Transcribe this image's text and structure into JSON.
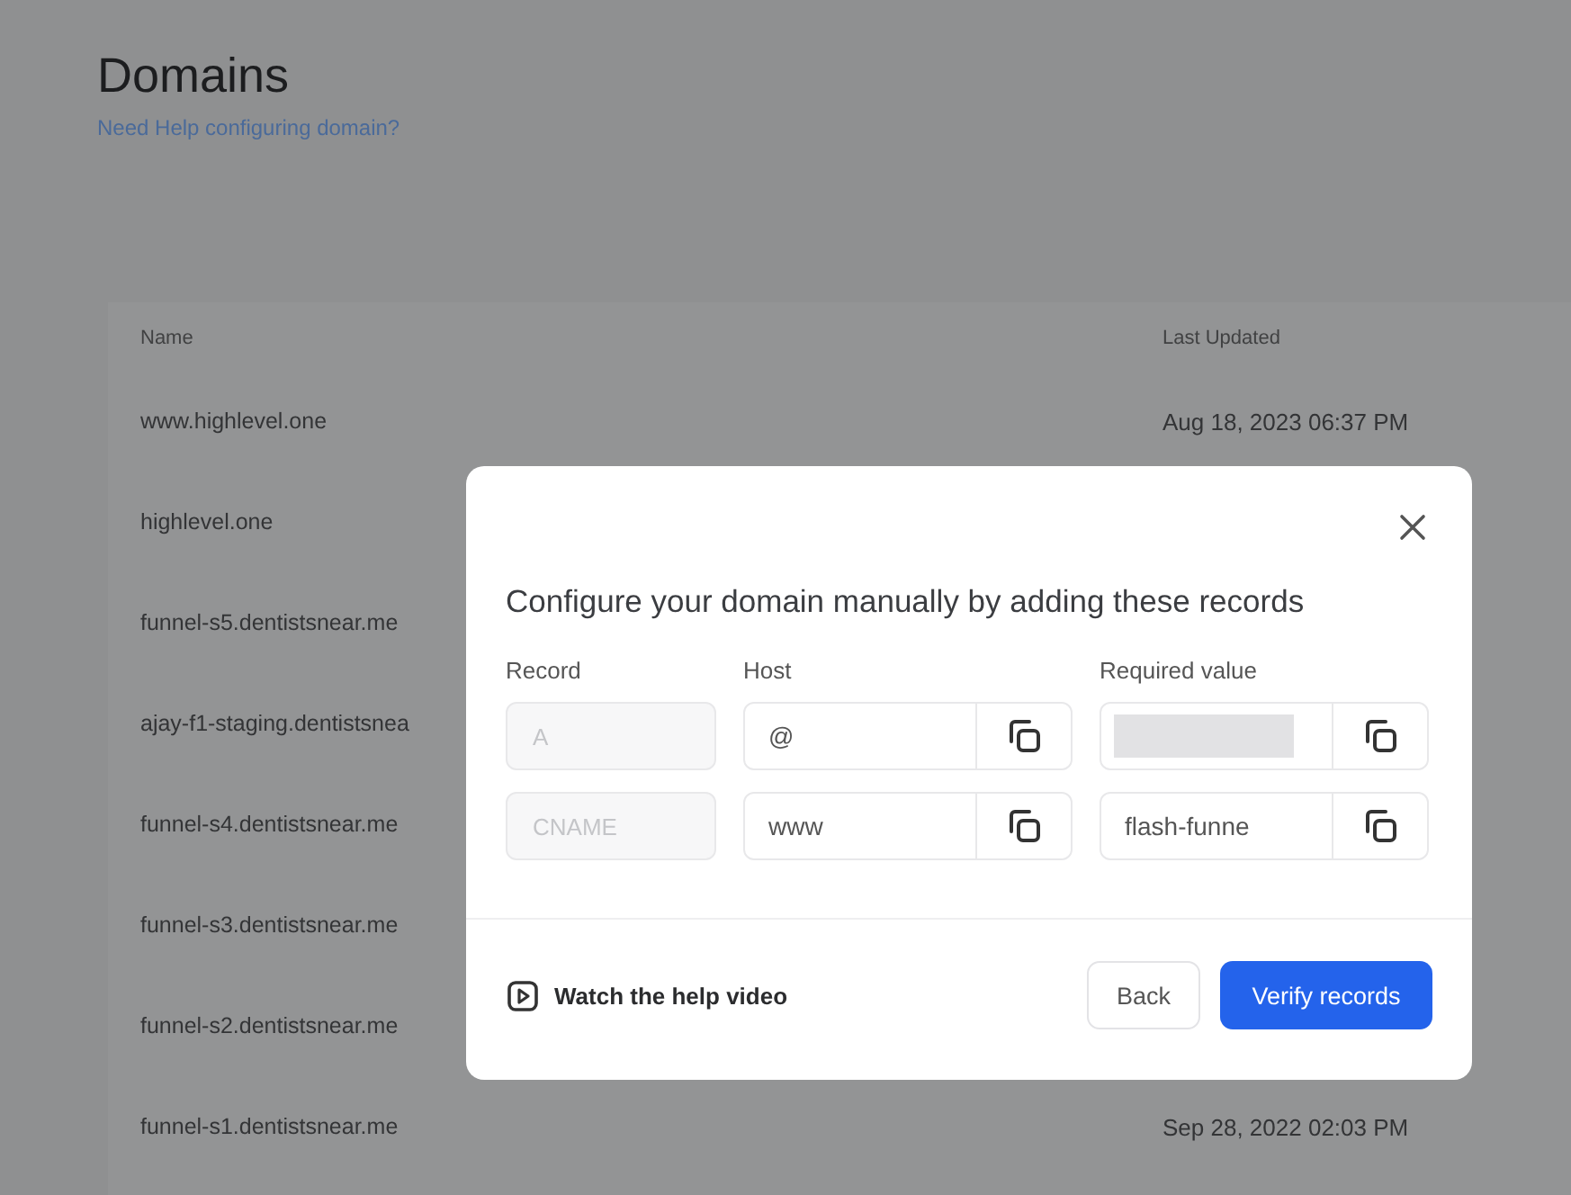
{
  "page": {
    "title": "Domains",
    "help_link": "Need Help configuring domain?"
  },
  "table": {
    "columns": [
      "Name",
      "Last Updated"
    ],
    "rows": [
      {
        "name": "www.highlevel.one",
        "last_updated": "Aug 18, 2023 06:37 PM"
      },
      {
        "name": "highlevel.one"
      },
      {
        "name": "funnel-s5.dentistsnear.me"
      },
      {
        "name": "ajay-f1-staging.dentistsnea"
      },
      {
        "name": "funnel-s4.dentistsnear.me"
      },
      {
        "name": "funnel-s3.dentistsnear.me"
      },
      {
        "name": "funnel-s2.dentistsnear.me"
      },
      {
        "name": "funnel-s1.dentistsnear.me",
        "last_updated": "Sep 28, 2022 02:03 PM"
      }
    ]
  },
  "modal": {
    "title": "Configure your domain manually by adding these records",
    "columns": [
      "Record",
      "Host",
      "Required value"
    ],
    "records": [
      {
        "type": "A",
        "type_disabled": true,
        "host": "@",
        "redacted": true
      },
      {
        "type": "CNAME",
        "type_disabled": true,
        "host": "www",
        "value": "flash-funne",
        "redacted": false
      }
    ],
    "help_video": "Watch the help video",
    "buttons": [
      {
        "label": "Back",
        "kind": "secondary"
      },
      {
        "label": "Verify records",
        "kind": "primary"
      }
    ]
  }
}
